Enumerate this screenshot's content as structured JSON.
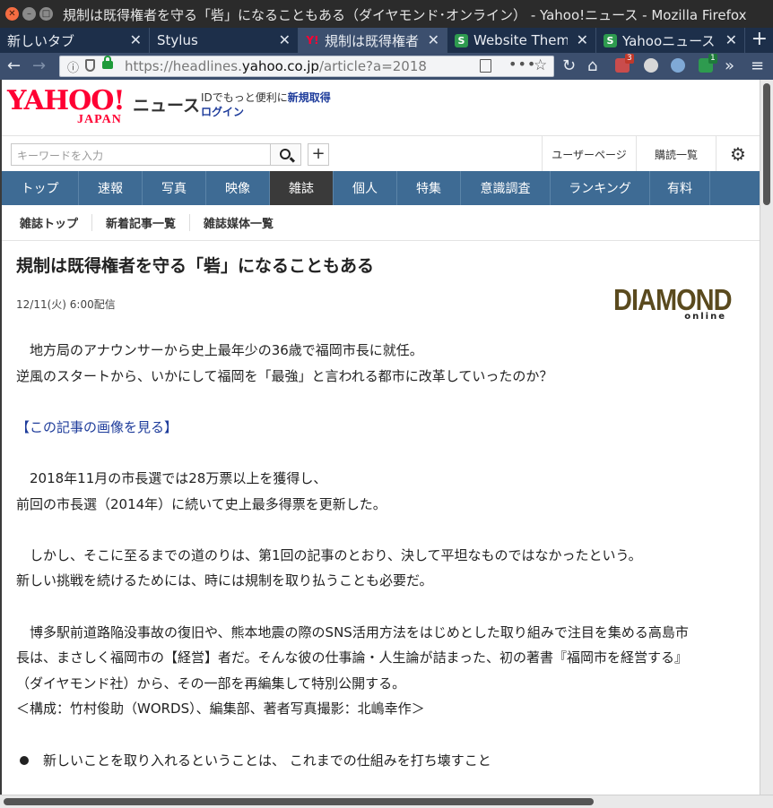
{
  "window": {
    "title": "規制は既得権者を守る「砦」になることもある（ダイヤモンド･オンライン） - Yahoo!ニュース - Mozilla Firefox"
  },
  "tabs": [
    {
      "label": "新しいタブ",
      "favicon": "none",
      "active": false
    },
    {
      "label": "Stylus",
      "favicon": "none",
      "active": false
    },
    {
      "label": "規制は既得権者",
      "favicon": "yahoo-icon",
      "active": true
    },
    {
      "label": "Website Themes",
      "favicon": "stylus-icon",
      "active": false
    },
    {
      "label": "Yahooニュース",
      "favicon": "stylus-icon",
      "active": false
    }
  ],
  "navbar": {
    "url_prefix": "https://headlines.",
    "url_host": "yahoo.co.jp",
    "url_path": "/article?a=2018",
    "ext_badge_1": "3",
    "ext_badge_2": "1"
  },
  "masthead": {
    "logo_text": "YAHOO!",
    "logo_sub": "JAPAN",
    "news_label": "ニュース",
    "id_promo": "IDでもっと便利に",
    "signup_link": "新規取得",
    "login_link": "ログイン"
  },
  "search": {
    "placeholder": "キーワードを入力",
    "plus_label": "+",
    "user_page": "ユーザーページ",
    "subscriptions": "購読一覧"
  },
  "global_nav": [
    {
      "label": "トップ",
      "active": false
    },
    {
      "label": "速報",
      "active": false
    },
    {
      "label": "写真",
      "active": false
    },
    {
      "label": "映像",
      "active": false
    },
    {
      "label": "雑誌",
      "active": true
    },
    {
      "label": "個人",
      "active": false
    },
    {
      "label": "特集",
      "active": false
    },
    {
      "label": "意識調査",
      "active": false
    },
    {
      "label": "ランキング",
      "active": false
    },
    {
      "label": "有料",
      "active": false
    }
  ],
  "sub_nav": [
    "雑誌トップ",
    "新着記事一覧",
    "雑誌媒体一覧"
  ],
  "article": {
    "headline": "規制は既得権者を守る「砦」になることもある",
    "date": "12/11(火) 6:00配信",
    "source_logo": "DIAMOND",
    "source_logo_sub": "online",
    "para1_line1": "　地方局のアナウンサーから史上最年少の36歳で福岡市長に就任。",
    "para1_line2": "逆風のスタートから、いかにして福岡を「最強」と言われる都市に改革していったのか？",
    "image_link": "【この記事の画像を見る】",
    "para2_line1": "　2018年11月の市長選では28万票以上を獲得し、",
    "para2_line2": "前回の市長選（2014年）に続いて史上最多得票を更新した。",
    "para3_line1": "　しかし、そこに至るまでの道のりは、第1回の記事のとおり、決して平坦なものではなかったという。",
    "para3_line2": "新しい挑戦を続けるためには、時には規制を取り払うことも必要だ。",
    "para4_line1": "　博多駅前道路陥没事故の復旧や、熊本地震の際のSNS活用方法をはじめとした取り組みで注目を集める高島市",
    "para4_line2": "長は、まさしく福岡市の【経営】者だ。そんな彼の仕事論・人生論が詰まった、初の著書『福岡市を経営する』",
    "para4_line3": "（ダイヤモンド社）から、その一部を再編集して特別公開する。",
    "para4_line4": "＜構成：竹村俊助（WORDS）、編集部、著者写真撮影：北嶋幸作＞",
    "bullet_heading": "新しいことを取り入れるということは、 これまでの仕組みを打ち壊すこと"
  }
}
